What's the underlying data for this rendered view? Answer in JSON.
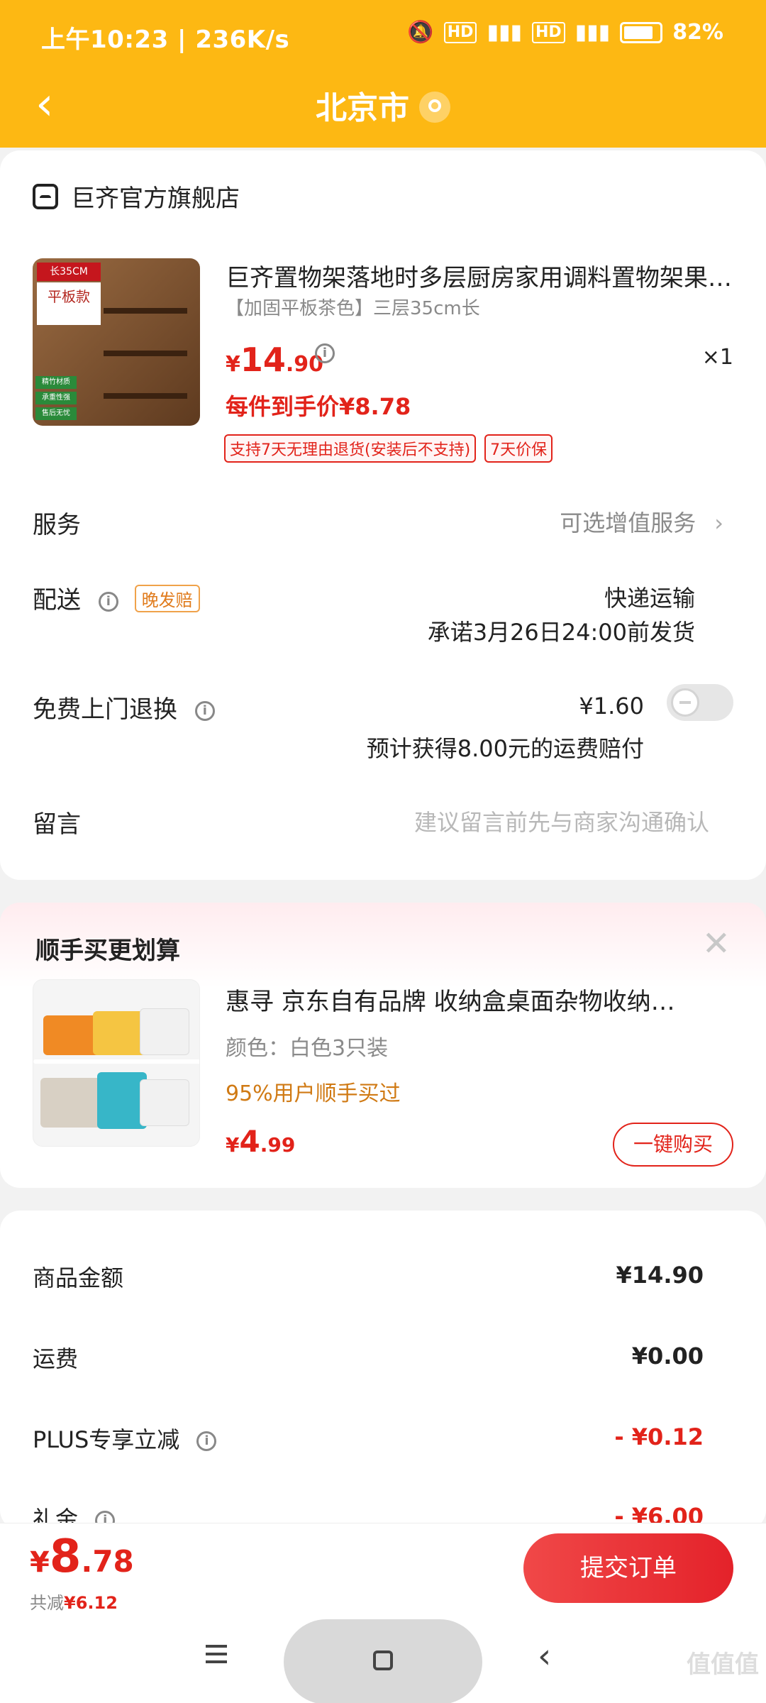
{
  "status_bar": {
    "time": "上午10:23 | 236K/s",
    "battery": "82%"
  },
  "header": {
    "title": "北京市"
  },
  "order": {
    "shop": "巨齐官方旗舰店",
    "product": {
      "title": "巨齐置物架落地时多层厨房家用调料置物架果…",
      "spec": "【加固平板茶色】三层35cm长",
      "price_yen": "¥",
      "price_int": "14",
      "price_dec": ".90",
      "quantity": "×1",
      "per_price": "每件到手价¥8.78",
      "badges": [
        "支持7天无理由退货(安装后不支持)",
        "7天价保"
      ],
      "image_tags": {
        "size": "长35CM",
        "style": "平板款",
        "feat": [
          "精竹材质",
          "承重性强",
          "售后无忧"
        ]
      }
    },
    "service": {
      "label": "服务",
      "value": "可选增值服务"
    },
    "delivery": {
      "label": "配送",
      "tag": "晚发赔",
      "method": "快递运输",
      "promise": "承诺3月26日24:00前发货"
    },
    "return": {
      "label": "免费上门退换",
      "price": "¥1.60",
      "note": "预计获得8.00元的运费赔付"
    },
    "message": {
      "label": "留言",
      "placeholder": "建议留言前先与商家沟通确认"
    }
  },
  "addon": {
    "title": "顺手买更划算",
    "product_name": "惠寻 京东自有品牌 收纳盒桌面杂物收纳…",
    "color": "颜色：白色3只装",
    "buyers": "95%用户顺手买过",
    "price_yen": "¥",
    "price_int": "4",
    "price_dec": ".99",
    "buy_label": "一键购买"
  },
  "summary": {
    "items": [
      {
        "label": "商品金额",
        "value": "¥14.90"
      },
      {
        "label": "运费",
        "value": "¥0.00"
      },
      {
        "label": "PLUS专享立减",
        "value": "- ¥0.12"
      },
      {
        "label": "礼金",
        "value": "- ¥6.00"
      }
    ]
  },
  "checkout": {
    "total_yen": "¥",
    "total_int": "8",
    "total_dec": ".78",
    "saved_label": "共减",
    "saved_value": "¥6.12",
    "submit_label": "提交订单"
  },
  "watermark": "值值值",
  "colors": {
    "header": "#fdb813",
    "accent": "#e2231a"
  }
}
